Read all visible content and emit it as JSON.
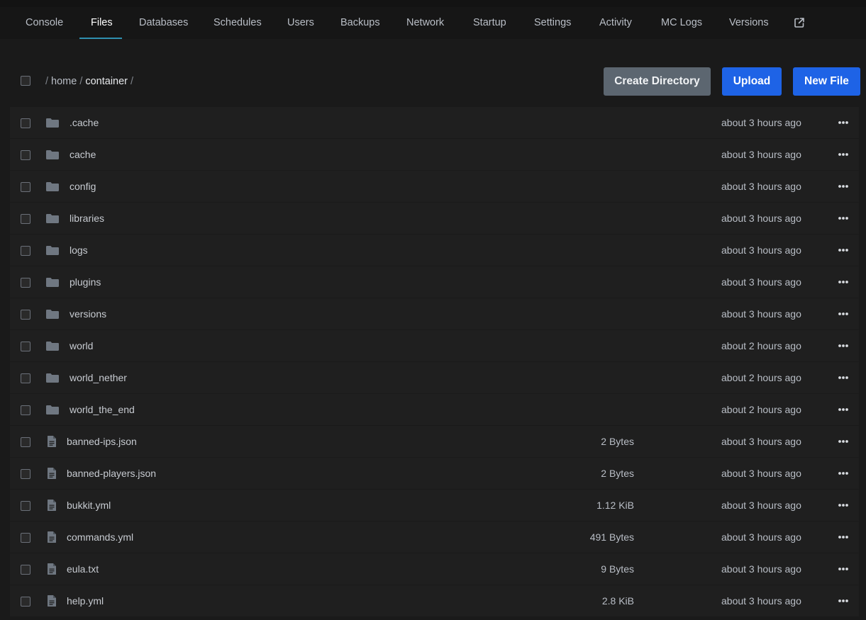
{
  "nav": {
    "tabs": [
      {
        "label": "Console",
        "active": false
      },
      {
        "label": "Files",
        "active": true
      },
      {
        "label": "Databases",
        "active": false
      },
      {
        "label": "Schedules",
        "active": false
      },
      {
        "label": "Users",
        "active": false
      },
      {
        "label": "Backups",
        "active": false
      },
      {
        "label": "Network",
        "active": false
      },
      {
        "label": "Startup",
        "active": false
      },
      {
        "label": "Settings",
        "active": false
      },
      {
        "label": "Activity",
        "active": false
      },
      {
        "label": "MC Logs",
        "active": false
      },
      {
        "label": "Versions",
        "active": false
      }
    ],
    "external_icon": "external-link-icon"
  },
  "breadcrumb": {
    "separator": "/",
    "segments": [
      "home",
      "container"
    ]
  },
  "toolbar": {
    "create_directory_label": "Create Directory",
    "upload_label": "Upload",
    "new_file_label": "New File"
  },
  "colors": {
    "accent": "#2f8fb0",
    "primary_button": "#1e63e6",
    "secondary_button": "#5c6670",
    "background": "#1a1a1a",
    "row_background": "#1f1f1f"
  },
  "files": [
    {
      "name": ".cache",
      "type": "folder",
      "size": "",
      "modified": "about 3 hours ago"
    },
    {
      "name": "cache",
      "type": "folder",
      "size": "",
      "modified": "about 3 hours ago"
    },
    {
      "name": "config",
      "type": "folder",
      "size": "",
      "modified": "about 3 hours ago"
    },
    {
      "name": "libraries",
      "type": "folder",
      "size": "",
      "modified": "about 3 hours ago"
    },
    {
      "name": "logs",
      "type": "folder",
      "size": "",
      "modified": "about 3 hours ago"
    },
    {
      "name": "plugins",
      "type": "folder",
      "size": "",
      "modified": "about 3 hours ago"
    },
    {
      "name": "versions",
      "type": "folder",
      "size": "",
      "modified": "about 3 hours ago"
    },
    {
      "name": "world",
      "type": "folder",
      "size": "",
      "modified": "about 2 hours ago"
    },
    {
      "name": "world_nether",
      "type": "folder",
      "size": "",
      "modified": "about 2 hours ago"
    },
    {
      "name": "world_the_end",
      "type": "folder",
      "size": "",
      "modified": "about 2 hours ago"
    },
    {
      "name": "banned-ips.json",
      "type": "file",
      "size": "2 Bytes",
      "modified": "about 3 hours ago"
    },
    {
      "name": "banned-players.json",
      "type": "file",
      "size": "2 Bytes",
      "modified": "about 3 hours ago"
    },
    {
      "name": "bukkit.yml",
      "type": "file",
      "size": "1.12 KiB",
      "modified": "about 3 hours ago"
    },
    {
      "name": "commands.yml",
      "type": "file",
      "size": "491 Bytes",
      "modified": "about 3 hours ago"
    },
    {
      "name": "eula.txt",
      "type": "file",
      "size": "9 Bytes",
      "modified": "about 3 hours ago"
    },
    {
      "name": "help.yml",
      "type": "file",
      "size": "2.8 KiB",
      "modified": "about 3 hours ago"
    }
  ]
}
